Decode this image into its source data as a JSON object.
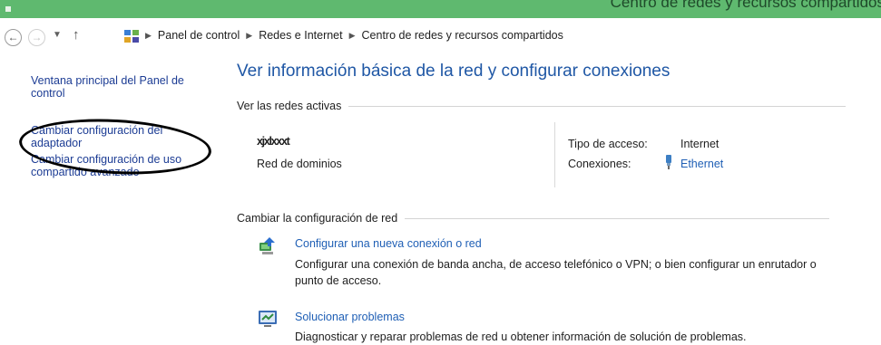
{
  "window": {
    "title": "Centro de redes y recursos compartidos"
  },
  "nav": {
    "back_icon": "back-arrow-icon",
    "forward_icon": "forward-arrow-icon",
    "up_icon": "up-arrow-icon",
    "breadcrumbs": [
      "Panel de control",
      "Redes e Internet",
      "Centro de redes y recursos compartidos"
    ]
  },
  "sidebar": {
    "items": [
      {
        "label": "Ventana principal del Panel de control"
      },
      {
        "label": "Cambiar configuración del adaptador"
      },
      {
        "label": "Cambiar configuración de uso compartido avanzado"
      }
    ]
  },
  "main": {
    "title": "Ver información básica de la red y configurar conexiones",
    "active_networks": {
      "heading": "Ver las redes activas",
      "network_name": "xjxlxxxt",
      "network_type": "Red de dominios",
      "access_type_label": "Tipo de acceso:",
      "access_type_value": "Internet",
      "connections_label": "Conexiones:",
      "connections_value": "Ethernet"
    },
    "change_settings": {
      "heading": "Cambiar la configuración de red",
      "tasks": [
        {
          "icon": "new-connection-icon",
          "link": "Configurar una nueva conexión o red",
          "description": "Configurar una conexión de banda ancha, de acceso telefónico o VPN; o bien configurar un enrutador o punto de acceso."
        },
        {
          "icon": "troubleshoot-icon",
          "link": "Solucionar problemas",
          "description": "Diagnosticar y reparar problemas de red u obtener información de solución de problemas."
        }
      ]
    }
  },
  "colors": {
    "titlebar": "#5fb96f",
    "link": "#1f5fb5",
    "title": "#1f57a5"
  }
}
